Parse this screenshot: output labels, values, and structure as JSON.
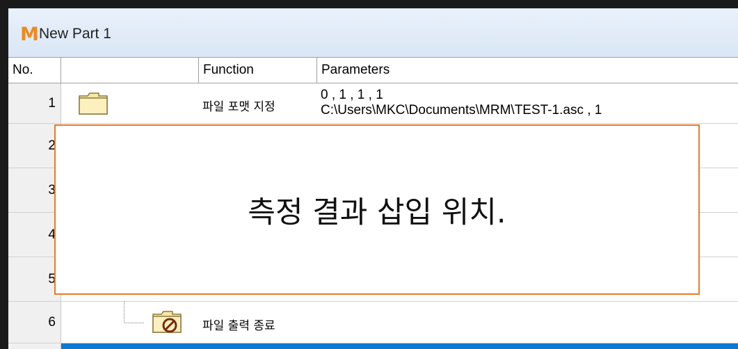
{
  "window": {
    "title": "New Part 1",
    "logo": "M"
  },
  "columns": {
    "no": "No.",
    "icon": "",
    "function": "Function",
    "parameters": "Parameters"
  },
  "rows": [
    {
      "no": "1",
      "function": "파일 포맷 지정",
      "param_line1": "0 , 1 , 1 , 1",
      "param_line2": "C:\\Users\\MKC\\Documents\\MRM\\TEST-1.asc , 1",
      "icon": "folder-icon"
    },
    {
      "no": "2"
    },
    {
      "no": "3"
    },
    {
      "no": "4"
    },
    {
      "no": "5"
    },
    {
      "no": "6",
      "function": "파일 출력 종료",
      "icon": "folder-close-icon"
    }
  ],
  "overlay": {
    "text": "측정 결과 삽입 위치."
  },
  "colors": {
    "accent_orange": "#e77b2a",
    "selection_blue": "#0a78d4"
  }
}
